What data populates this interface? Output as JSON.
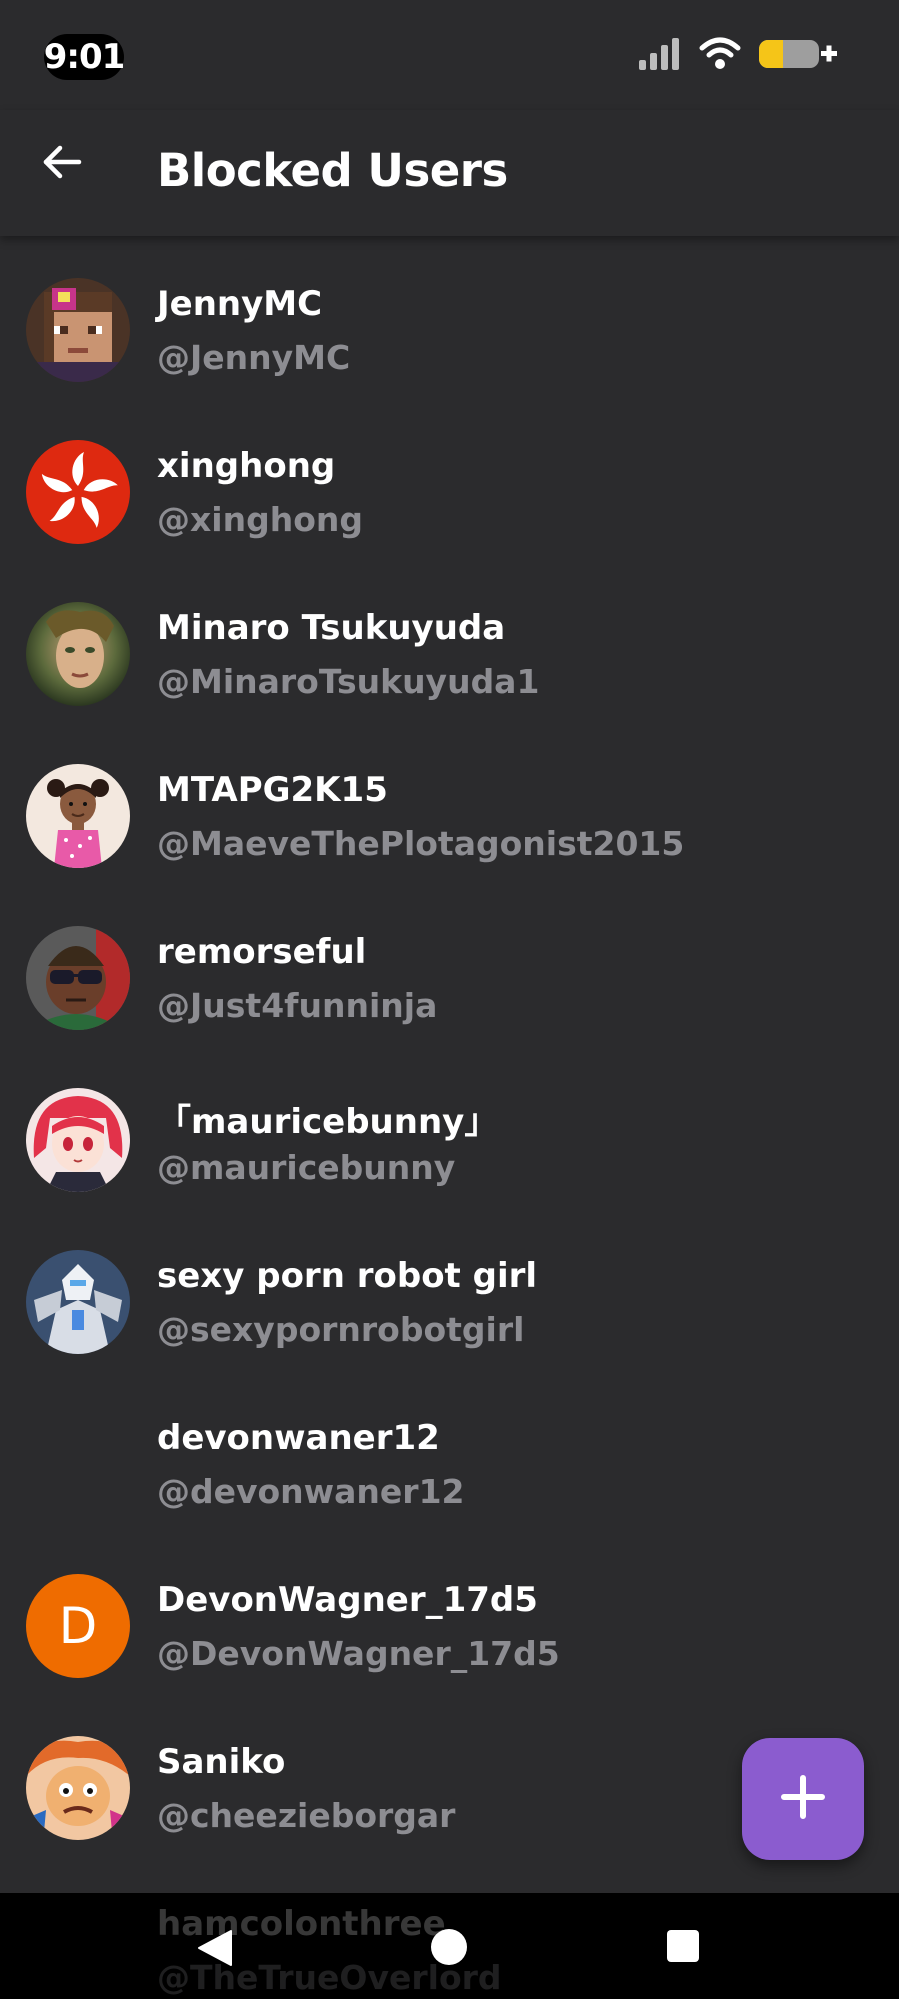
{
  "status_bar": {
    "time": "9:01",
    "icons": [
      "signal-icon",
      "wifi-icon",
      "battery-charging-icon"
    ],
    "battery_color": "#f5c518"
  },
  "header": {
    "title": "Blocked Users",
    "back_icon": "arrow-left-icon"
  },
  "users": [
    {
      "name": "JennyMC",
      "handle": "@JennyMC",
      "avatar": "minecraft-skin"
    },
    {
      "name": "xinghong",
      "handle": "@xinghong",
      "avatar": "hong-kong-flag"
    },
    {
      "name": "Minaro Tsukuyuda",
      "handle": "@MinaroTsukuyuda1",
      "avatar": "fantasy-portrait"
    },
    {
      "name": "MTAPG2K15",
      "handle": "@MaeveThePlotagonist2015",
      "avatar": "cartoon-girl"
    },
    {
      "name": "remorseful",
      "handle": "@Just4funninja",
      "avatar": "sunglasses-character"
    },
    {
      "name": "「mauricebunny」",
      "handle": "@mauricebunny",
      "avatar": "anime-girl-pink-hair"
    },
    {
      "name": "sexy porn robot girl",
      "handle": "@sexypornrobotgirl",
      "avatar": "robot-armor"
    },
    {
      "name": "devonwaner12",
      "handle": "@devonwaner12",
      "avatar": "none"
    },
    {
      "name": "DevonWagner_17d5",
      "handle": "@DevonWagner_17d5",
      "avatar": "letter",
      "initial": "D",
      "avatar_color": "#ef6c00"
    },
    {
      "name": "Saniko",
      "handle": "@cheezieborgar",
      "avatar": "cartoon-face"
    }
  ],
  "partial_user": {
    "name": "hamcolonthree",
    "handle": "@TheTrueOverlord"
  },
  "fab": {
    "icon": "plus-icon",
    "color": "#8b5ccf"
  },
  "nav_bar": {
    "icons": [
      "nav-back-icon",
      "nav-home-icon",
      "nav-recents-icon"
    ]
  }
}
